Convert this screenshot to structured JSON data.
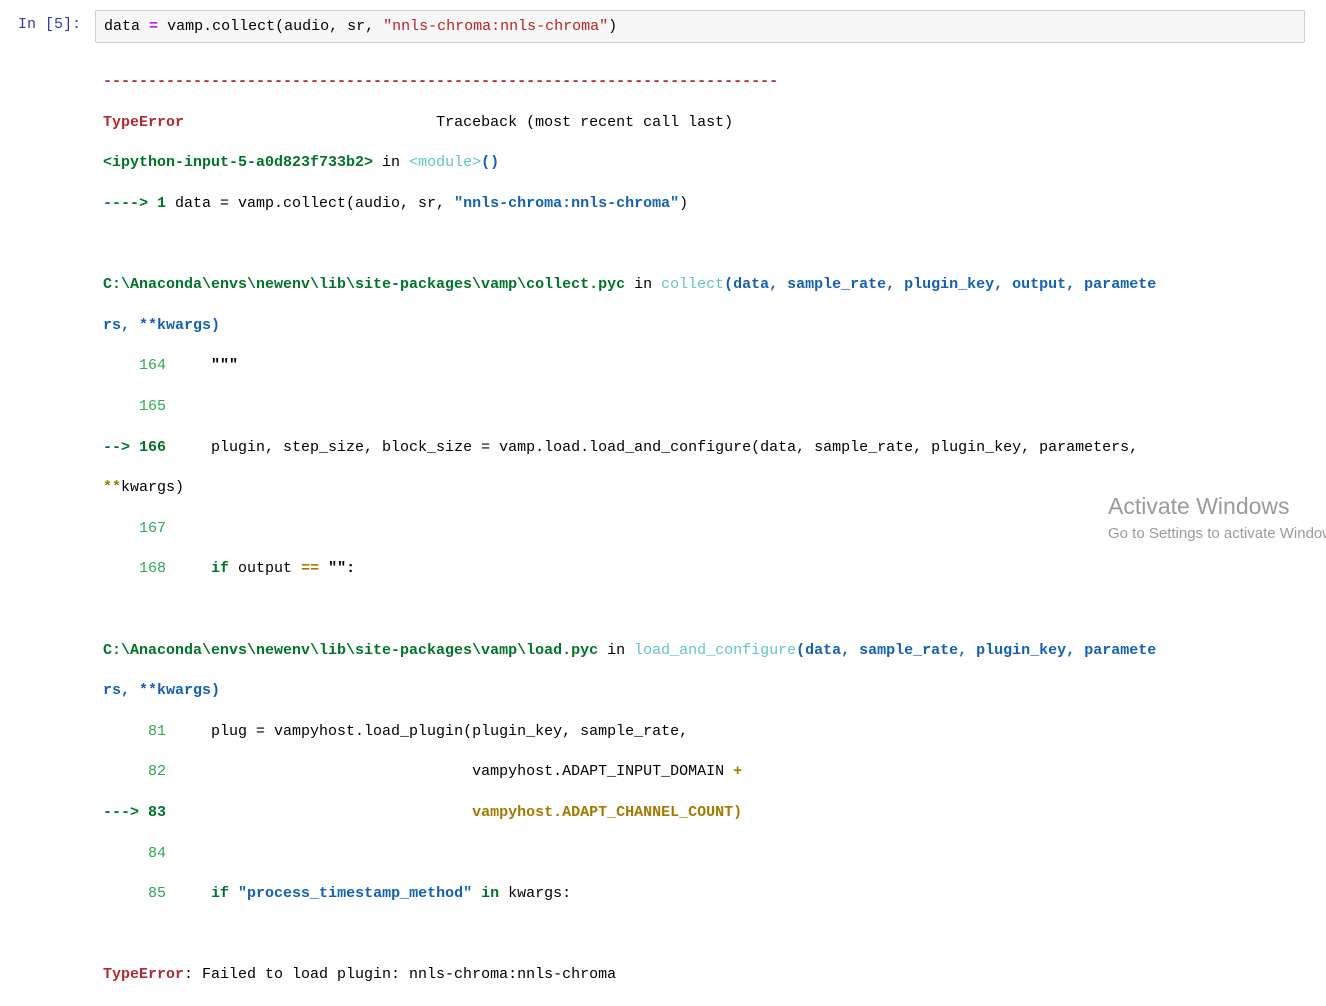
{
  "cell": {
    "prompt": "In [5]:",
    "code": {
      "var": "data",
      "op": "=",
      "call": "vamp.collect(audio, sr, ",
      "str": "\"nnls-chroma:nnls-chroma\"",
      "close": ")"
    }
  },
  "traceback": {
    "dashes": "---------------------------------------------------------------------------",
    "error_type": "TypeError",
    "header_right": "Traceback (most recent call last)",
    "frame1": {
      "location": "<ipython-input-5-a0d823f733b2>",
      "in": " in ",
      "module": "<module>",
      "parens": "()",
      "arrow": "----> 1",
      "code": " data = vamp.collect(audio, sr, ",
      "code_str": "\"nnls-chroma:nnls-chroma\"",
      "code_close": ")"
    },
    "frame2": {
      "path": "C:\\Anaconda\\envs\\newenv\\lib\\site-packages\\vamp\\collect.pyc",
      "in": " in ",
      "func": "collect",
      "sig1": "(data, sample_rate, plugin_key, output, paramete",
      "sig2": "rs, **kwargs)",
      "l164_no": "    164",
      "l164_code": "     \"\"\"",
      "l165_no": "    165",
      "l166_arrow": "--> 166",
      "l166_code": "     plugin, step_size, block_size = vamp.load.load_and_configure(data, sample_rate, plugin_key, parameters,",
      "l166_cont_op": "**",
      "l166_cont": "kwargs)",
      "l167_no": "    167",
      "l168_no": "    168",
      "l168_kw": "if",
      "l168_code": " output ",
      "l168_op": "==",
      "l168_str": " \"\":"
    },
    "frame3": {
      "path": "C:\\Anaconda\\envs\\newenv\\lib\\site-packages\\vamp\\load.pyc",
      "in": " in ",
      "func": "load_and_configure",
      "sig1": "(data, sample_rate, plugin_key, paramete",
      "sig2": "rs, **kwargs)",
      "l81_no": "     81",
      "l81_code": "     plug = vampyhost.load_plugin(plugin_key, sample_rate,",
      "l82_no": "     82",
      "l82_code": "                                  vampyhost.ADAPT_INPUT_DOMAIN ",
      "l82_op": "+",
      "l83_arrow": "---> 83",
      "l83_code": "                                  vampyhost.ADAPT_CHANNEL_COUNT)",
      "l84_no": "     84",
      "l85_no": "     85",
      "l85_kw": "if",
      "l85_str": " \"process_timestamp_method\"",
      "l85_kw2": " in",
      "l85_code": " kwargs:"
    },
    "final_error_type": "TypeError",
    "final_message": ": Failed to load plugin: nnls-chroma:nnls-chroma"
  },
  "watermark": {
    "title": "Activate Windows",
    "subtitle": "Go to Settings to activate Windows."
  }
}
